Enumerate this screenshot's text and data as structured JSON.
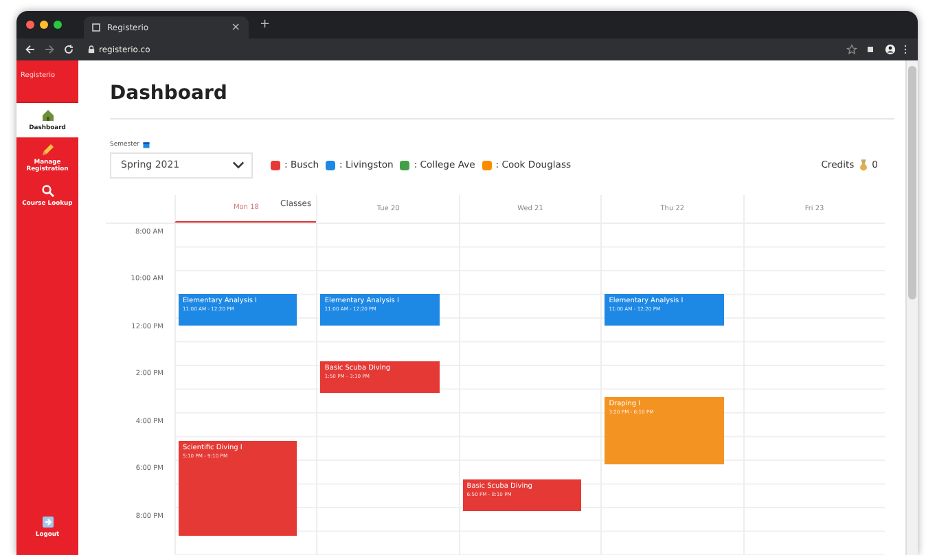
{
  "browser": {
    "tab_title": "Registerio",
    "new_tab": "+",
    "close_tab": "×",
    "url": "registerio.co"
  },
  "sidebar": {
    "brand": "Registerio",
    "items": [
      {
        "label": "Dashboard",
        "selected": true
      },
      {
        "label": "Manage Registration",
        "selected": false
      },
      {
        "label": "Course Lookup",
        "selected": false
      }
    ],
    "logout": "Logout"
  },
  "page": {
    "title": "Dashboard"
  },
  "semester": {
    "label": "Semester",
    "value": "Spring 2021"
  },
  "legend": [
    {
      "label": ": Busch",
      "color": "#e53935"
    },
    {
      "label": ": Livingston",
      "color": "#1e88e5"
    },
    {
      "label": ": College Ave",
      "color": "#43a047"
    },
    {
      "label": ": Cook Douglass",
      "color": "#fb8c00"
    }
  ],
  "credits": {
    "label": "Credits",
    "value": "0"
  },
  "calendar": {
    "caption": "Classes",
    "time_labels": [
      "8:00 AM",
      "10:00 AM",
      "12:00 PM",
      "2:00 PM",
      "4:00 PM",
      "6:00 PM",
      "8:00 PM"
    ],
    "days": [
      {
        "label": "Mon 18",
        "selected": true,
        "events": [
          {
            "title": "Elementary Analysis I",
            "time": "11:00 AM - 12:20 PM",
            "color": "#1e88e5"
          },
          {
            "title": "Scientific Diving I",
            "time": "5:10 PM - 9:10 PM",
            "color": "#e53935"
          }
        ]
      },
      {
        "label": "Tue 20",
        "selected": false,
        "events": [
          {
            "title": "Elementary Analysis I",
            "time": "11:00 AM - 12:20 PM",
            "color": "#1e88e5"
          },
          {
            "title": "Basic Scuba Diving",
            "time": "1:50 PM - 3:10 PM",
            "color": "#e53935"
          }
        ]
      },
      {
        "label": "Wed 21",
        "selected": false,
        "events": [
          {
            "title": "Basic Scuba Diving",
            "time": "6:50 PM - 8:10 PM",
            "color": "#e53935"
          }
        ]
      },
      {
        "label": "Thu 22",
        "selected": false,
        "events": [
          {
            "title": "Elementary Analysis I",
            "time": "11:00 AM - 12:20 PM",
            "color": "#1e88e5"
          },
          {
            "title": "Draping I",
            "time": "3:20 PM - 6:10 PM",
            "color": "#f39322"
          }
        ]
      },
      {
        "label": "Fri 23",
        "selected": false
      }
    ]
  }
}
